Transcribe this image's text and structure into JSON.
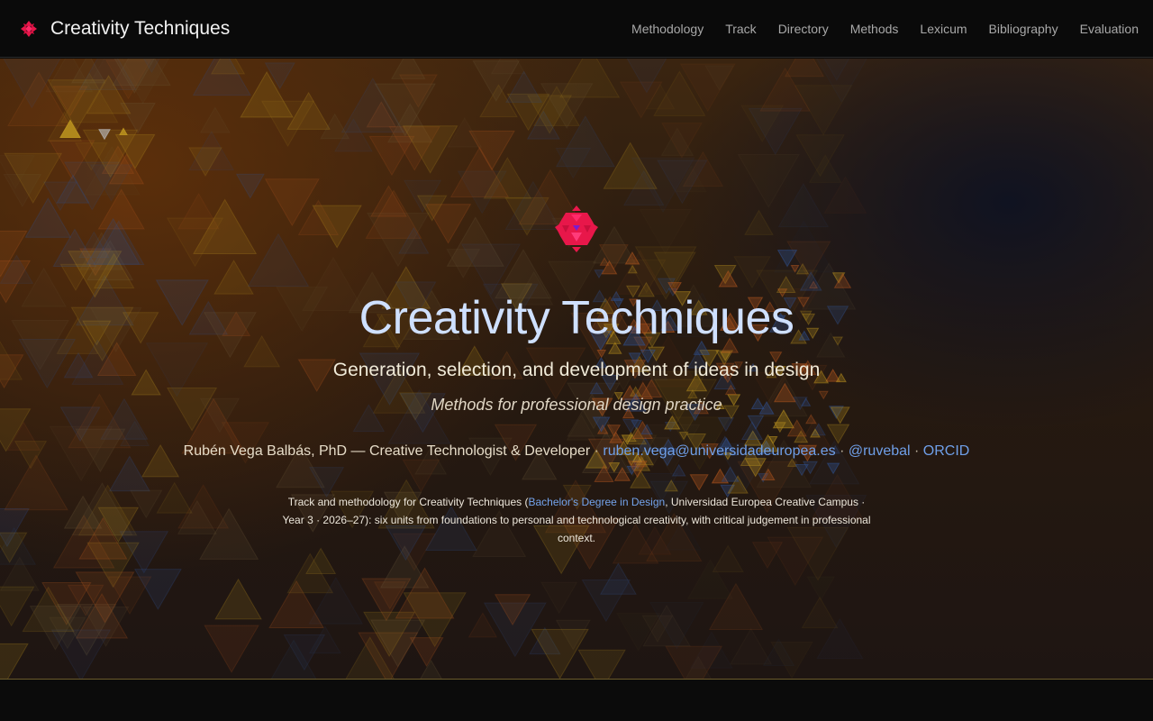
{
  "header": {
    "title": "Creativity Techniques",
    "nav": [
      {
        "label": "Methodology"
      },
      {
        "label": "Track"
      },
      {
        "label": "Directory"
      },
      {
        "label": "Methods"
      },
      {
        "label": "Lexicum"
      },
      {
        "label": "Bibliography"
      },
      {
        "label": "Evaluation"
      }
    ]
  },
  "hero": {
    "title": "Creativity Techniques",
    "subtitle": "Generation, selection, and development of ideas in design",
    "tagline": "Methods for professional design practice",
    "author": {
      "name_role": "Rubén Vega Balbás, PhD — Creative Technologist & Developer",
      "sep": "·",
      "email": "ruben.vega@universidadeuropea.es",
      "handle": "@ruvebal",
      "orcid": "ORCID"
    },
    "description": {
      "prefix": "Track and methodology for Creativity Techniques (",
      "link": "Bachelor's Degree in Design",
      "suffix": ", Universidad Europea Creative Campus · Year 3 · 2026–27): six units from foundations to personal and technological creativity, with critical judgement in professional context."
    }
  },
  "colors": {
    "logo": "#e8174a",
    "logo_accent": "#ff2a6a",
    "title": "#cfe0ff",
    "link": "#6f9fe8",
    "triangle_gold": "#b8901e",
    "triangle_orange": "#b4561e",
    "triangle_blue": "#2f4f8c"
  },
  "icons": {
    "brand_logo": "fractal-flower-icon",
    "hero_logo": "fractal-flower-icon"
  }
}
